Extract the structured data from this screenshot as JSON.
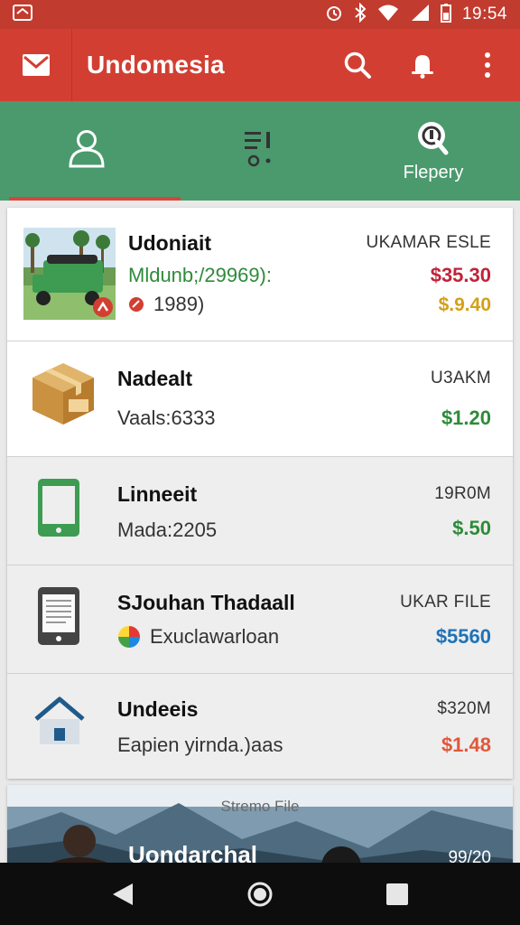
{
  "status_bar": {
    "time": "19:54"
  },
  "app_bar": {
    "title": "Undomesia"
  },
  "tabs": [
    {
      "label": "",
      "icon": "person-icon",
      "selected": true
    },
    {
      "label": "",
      "icon": "list-icon",
      "selected": false
    },
    {
      "label": "Flepery",
      "icon": "search-badge-icon",
      "selected": false
    }
  ],
  "items": [
    {
      "title": "Udoniait",
      "subtitle": "Mldunb;/29969):",
      "detail": "1989)",
      "meta": "UKAMAR ESLE",
      "price": "$35.30",
      "price2": "$.9.40",
      "icon": "delivery-truck-photo"
    },
    {
      "title": "Nadealt",
      "subtitle": "Vaals:6333",
      "meta": "U3AKM",
      "price": "$1.20",
      "icon": "package-box-icon"
    },
    {
      "title": "Linneeit",
      "subtitle": "Mada:2205",
      "meta": "19R0M",
      "price": "$.50",
      "icon": "phone-icon"
    },
    {
      "title": "SJouhan Thadaall",
      "subtitle": "Exuclawarloan",
      "meta": "UKAR FILE",
      "price": "$5560",
      "icon": "document-icon"
    },
    {
      "title": "Undeeis",
      "subtitle": "Eapien yirnda.)aas",
      "meta": "$320M",
      "price": "$1.48",
      "icon": "home-icon"
    }
  ],
  "banner": {
    "caption": "Stremo File",
    "title": "Uondarchal",
    "meta": "99/20"
  },
  "colors": {
    "status_bar": "#c23b2f",
    "app_bar": "#d23f32",
    "tab_bar": "#4a9a6e",
    "tab_indicator": "#d9453a",
    "price_green": "#2e8b3a",
    "price_red": "#c0233a",
    "price_amber": "#d4a017",
    "price_blue": "#1f73b7",
    "price_orange": "#e0583a"
  }
}
